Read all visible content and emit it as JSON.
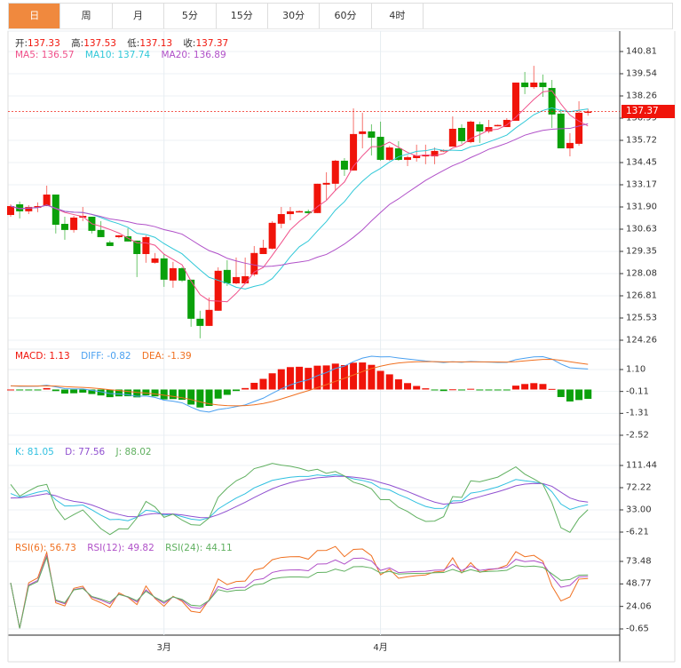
{
  "tabs": [
    {
      "label": "日"
    },
    {
      "label": "周"
    },
    {
      "label": "月"
    },
    {
      "label": "5分"
    },
    {
      "label": "15分"
    },
    {
      "label": "30分"
    },
    {
      "label": "60分"
    },
    {
      "label": "4时"
    }
  ],
  "active_tab": 0,
  "ohlc_legend": {
    "open_label": "开:",
    "open": "137.33",
    "high_label": "高:",
    "high": "137.53",
    "low_label": "低:",
    "low": "137.13",
    "close_label": "收:",
    "close": "137.37"
  },
  "ma_legend": {
    "ma5": "MA5: 136.57",
    "ma10": "MA10: 137.74",
    "ma20": "MA20: 136.89"
  },
  "macd_legend": {
    "macd": "MACD: 1.13",
    "diff": "DIFF: -0.82",
    "dea": "DEA: -1.39"
  },
  "kdj_legend": {
    "k": "K: 81.05",
    "d": "D: 77.56",
    "j": "J: 88.02"
  },
  "rsi_legend": {
    "rsi6": "RSI(6): 56.73",
    "rsi12": "RSI(12): 49.82",
    "rsi24": "RSI(24): 44.11"
  },
  "last_price": "137.37",
  "colors": {
    "up": "#f0140a",
    "down": "#0aa00a",
    "ma5": "#f0508a",
    "ma10": "#30c8d8",
    "ma20": "#b050c8",
    "diff": "#4aa0f0",
    "dea": "#f07020",
    "k": "#30c0e0",
    "d": "#9050d0",
    "j": "#60b060",
    "rsi6": "#f07020",
    "rsi12": "#b050c8",
    "rsi24": "#60b060",
    "active_tab": "#f0893e"
  },
  "chart_data": {
    "type": "candlestick",
    "x_labels": [
      {
        "index": 17,
        "label": "3月"
      },
      {
        "index": 41,
        "label": "4月"
      }
    ],
    "price_axis": {
      "ticks": [
        "140.81",
        "139.54",
        "138.26",
        "136.99",
        "135.72",
        "134.45",
        "133.17",
        "131.90",
        "130.63",
        "129.35",
        "128.08",
        "126.81",
        "125.53",
        "124.26"
      ],
      "range": [
        124.26,
        140.81
      ]
    },
    "macd_axis": {
      "ticks": [
        "1.10",
        "-0.11",
        "-1.31",
        "-2.52"
      ],
      "range": [
        -2.52,
        1.1
      ]
    },
    "kdj_axis": {
      "ticks": [
        "111.44",
        "72.22",
        "33.00",
        "-6.21"
      ],
      "range": [
        -6.21,
        111.44
      ]
    },
    "rsi_axis": {
      "ticks": [
        "73.48",
        "48.77",
        "24.06",
        "-0.65"
      ],
      "range": [
        -0.65,
        73.48
      ]
    },
    "candles": [
      [
        131.44,
        132.05,
        131.34,
        131.95
      ],
      [
        132.05,
        132.21,
        131.24,
        131.65
      ],
      [
        131.65,
        132.0,
        131.49,
        131.9
      ],
      [
        131.85,
        132.16,
        131.6,
        131.95
      ],
      [
        131.95,
        133.12,
        131.95,
        132.61
      ],
      [
        132.61,
        132.61,
        130.38,
        130.88
      ],
      [
        130.93,
        131.34,
        130.02,
        130.58
      ],
      [
        130.58,
        131.39,
        130.43,
        131.29
      ],
      [
        131.29,
        131.9,
        131.09,
        131.39
      ],
      [
        131.34,
        131.34,
        130.38,
        130.53
      ],
      [
        130.58,
        131.09,
        130.17,
        130.17
      ],
      [
        129.87,
        129.97,
        129.66,
        129.66
      ],
      [
        130.17,
        130.3,
        130.1,
        130.27
      ],
      [
        130.22,
        130.68,
        129.92,
        129.92
      ],
      [
        129.97,
        129.97,
        127.88,
        129.2
      ],
      [
        129.2,
        130.27,
        128.7,
        130.17
      ],
      [
        128.7,
        129.26,
        128.65,
        128.95
      ],
      [
        128.95,
        129.2,
        127.32,
        127.73
      ],
      [
        127.68,
        128.75,
        127.27,
        128.39
      ],
      [
        128.39,
        128.45,
        127.6,
        127.68
      ],
      [
        127.73,
        127.73,
        125.03,
        125.49
      ],
      [
        125.49,
        125.95,
        124.37,
        125.08
      ],
      [
        125.08,
        126.71,
        125.08,
        126.0
      ],
      [
        125.95,
        128.44,
        125.95,
        128.24
      ],
      [
        128.29,
        128.85,
        127.37,
        127.52
      ],
      [
        127.52,
        129.0,
        127.47,
        127.88
      ],
      [
        127.52,
        129.0,
        127.47,
        127.93
      ],
      [
        128.03,
        129.66,
        127.93,
        129.26
      ],
      [
        129.2,
        130.02,
        129.2,
        129.56
      ],
      [
        129.51,
        131.09,
        129.46,
        130.99
      ],
      [
        130.94,
        131.9,
        130.68,
        131.49
      ],
      [
        131.49,
        131.9,
        131.14,
        131.65
      ],
      [
        131.63,
        131.7,
        131.6,
        131.66
      ],
      [
        131.65,
        131.75,
        131.45,
        131.55
      ],
      [
        131.55,
        133.23,
        131.55,
        133.23
      ],
      [
        133.18,
        133.89,
        132.31,
        133.28
      ],
      [
        133.23,
        134.6,
        132.82,
        134.55
      ],
      [
        134.55,
        134.7,
        133.68,
        134.04
      ],
      [
        133.99,
        137.55,
        133.99,
        136.08
      ],
      [
        136.08,
        137.3,
        135.26,
        136.23
      ],
      [
        136.23,
        136.64,
        134.85,
        135.87
      ],
      [
        135.92,
        136.79,
        134.55,
        134.6
      ],
      [
        134.6,
        135.4,
        134.55,
        135.31
      ],
      [
        135.26,
        135.67,
        134.55,
        134.6
      ],
      [
        134.6,
        134.85,
        134.24,
        134.75
      ],
      [
        134.7,
        135.47,
        134.5,
        134.85
      ],
      [
        134.8,
        135.47,
        134.35,
        134.9
      ],
      [
        134.8,
        135.31,
        134.35,
        135.11
      ],
      [
        135.11,
        135.2,
        135.05,
        135.16
      ],
      [
        135.36,
        137.09,
        135.36,
        136.38
      ],
      [
        136.43,
        136.64,
        135.52,
        135.67
      ],
      [
        135.62,
        136.85,
        135.55,
        136.79
      ],
      [
        136.64,
        136.79,
        135.57,
        136.23
      ],
      [
        136.23,
        136.89,
        136.13,
        136.48
      ],
      [
        136.55,
        136.62,
        136.52,
        136.6
      ],
      [
        136.48,
        136.99,
        136.48,
        136.89
      ],
      [
        136.84,
        139.03,
        136.84,
        139.03
      ],
      [
        139.03,
        139.64,
        138.37,
        138.77
      ],
      [
        138.77,
        139.99,
        138.67,
        139.03
      ],
      [
        139.03,
        139.49,
        138.21,
        138.77
      ],
      [
        138.72,
        139.18,
        136.43,
        137.2
      ],
      [
        137.25,
        137.5,
        135.26,
        135.26
      ],
      [
        135.26,
        136.13,
        134.8,
        135.57
      ],
      [
        135.52,
        137.96,
        135.41,
        137.3
      ],
      [
        137.33,
        137.53,
        137.13,
        137.37
      ]
    ]
  }
}
